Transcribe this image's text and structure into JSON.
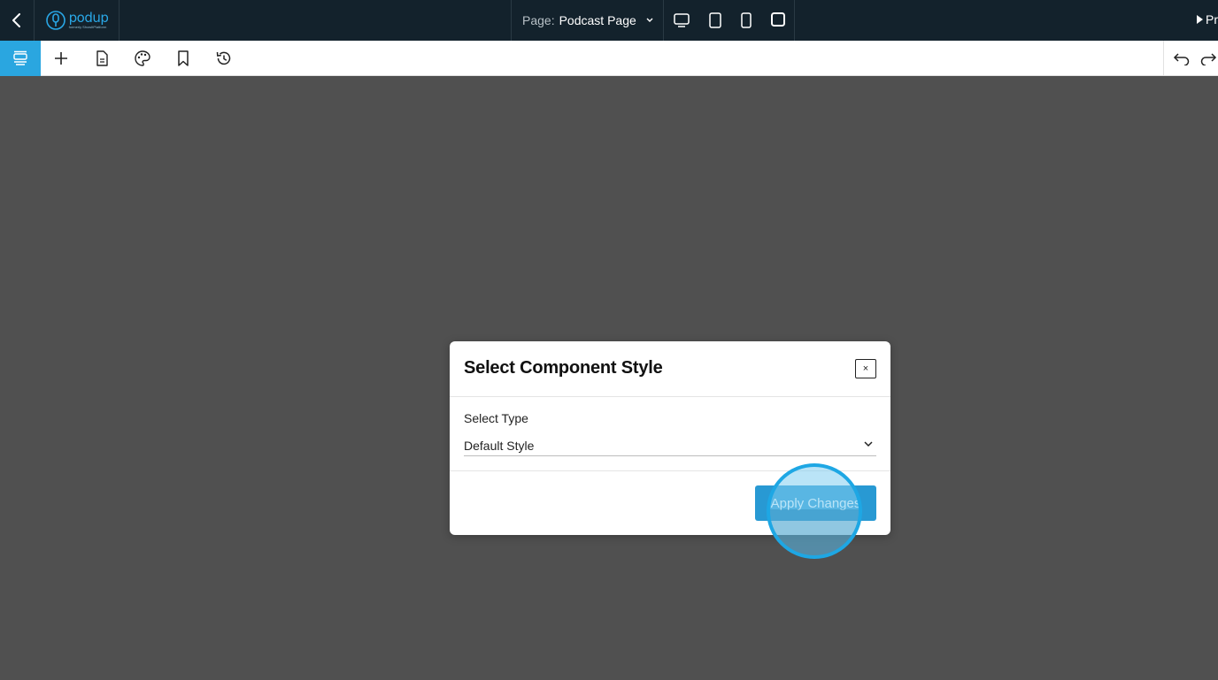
{
  "header": {
    "logo": {
      "word": "podup",
      "subtitle": "formerly ShowItPlatform"
    },
    "page_label": "Page:",
    "page_value": "Podcast Page",
    "preview_label": "Pr",
    "devices": [
      "desktop-icon",
      "tablet-icon",
      "mobile-icon",
      "fullscreen-icon"
    ]
  },
  "toolbar": {
    "items": [
      "layers-icon",
      "add-icon",
      "page-icon",
      "palette-icon",
      "bookmark-icon",
      "history-icon"
    ],
    "right_items": [
      "undo-icon",
      "redo-icon"
    ]
  },
  "modal": {
    "title": "Select Component Style",
    "close_label": "×",
    "field_label": "Select Type",
    "select_value": "Default Style",
    "apply_label": "Apply Changes"
  },
  "colors": {
    "topbar": "#13222c",
    "accent": "#2aa6e0",
    "button": "#2899d3",
    "canvas": "#505050"
  }
}
